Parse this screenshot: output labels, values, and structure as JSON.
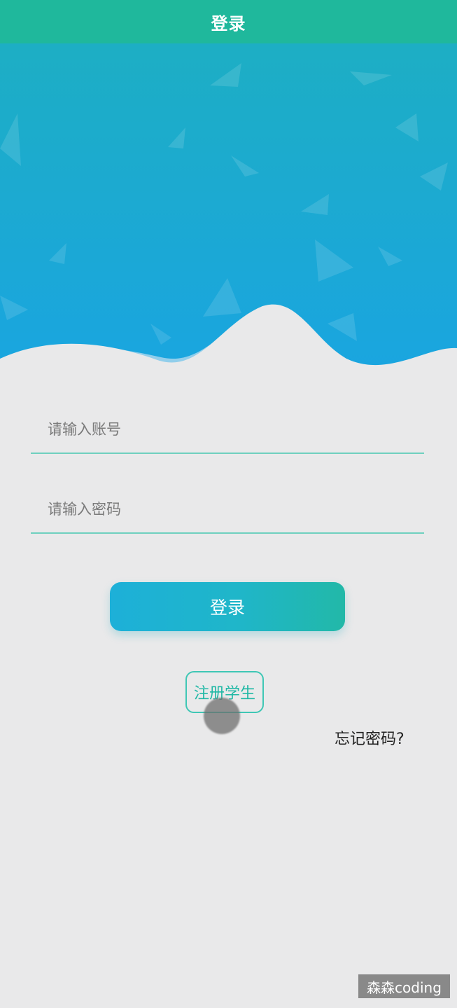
{
  "header": {
    "title": "登录"
  },
  "form": {
    "account_placeholder": "请输入账号",
    "password_placeholder": "请输入密码",
    "login_label": "登录",
    "register_label": "注册学生",
    "forgot_label": "忘记密码?"
  },
  "watermark": {
    "text": "森森coding"
  },
  "colors": {
    "header": "#1fb89c",
    "hero_top": "#1aa9c9",
    "hero_bottom": "#1aa2e0",
    "accent": "#1fb8a5",
    "background": "#e9e9ea"
  }
}
